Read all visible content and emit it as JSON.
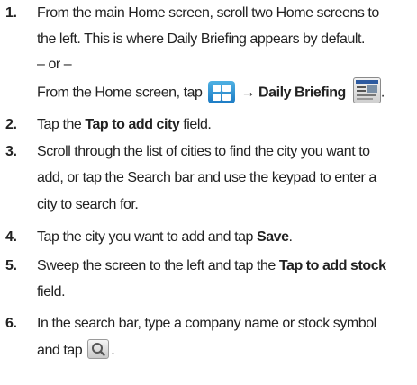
{
  "steps": [
    {
      "number": "1.",
      "line1": "From the main Home screen, scroll two Home screens to",
      "line2": "the left. This is where Daily Briefing appears by default.",
      "or": "– or –",
      "alt_prefix": "From the Home screen, tap",
      "arrow": " → ",
      "alt_target": "Daily Briefing",
      "alt_end": "."
    },
    {
      "number": "2.",
      "pre": "Tap the ",
      "bold": "Tap to add city",
      "post": " field."
    },
    {
      "number": "3.",
      "line1": "Scroll through the list of cities to find the city you want to",
      "line2": "add, or tap the Search bar and use the keypad to enter a",
      "line3": "city to search for."
    },
    {
      "number": "4.",
      "pre": "Tap the city you want to add and tap ",
      "bold": "Save",
      "post": "."
    },
    {
      "number": "5.",
      "pre": "Sweep the screen to the left and tap the ",
      "bold": "Tap to add stock",
      "line2": "field."
    },
    {
      "number": "6.",
      "line1": "In the search bar, type a company name or stock symbol",
      "line2_pre": "and tap",
      "line2_post": "."
    }
  ],
  "icons": {
    "apps": "apps-grid-icon",
    "daily_briefing": "daily-briefing-icon",
    "search": "search-icon"
  }
}
